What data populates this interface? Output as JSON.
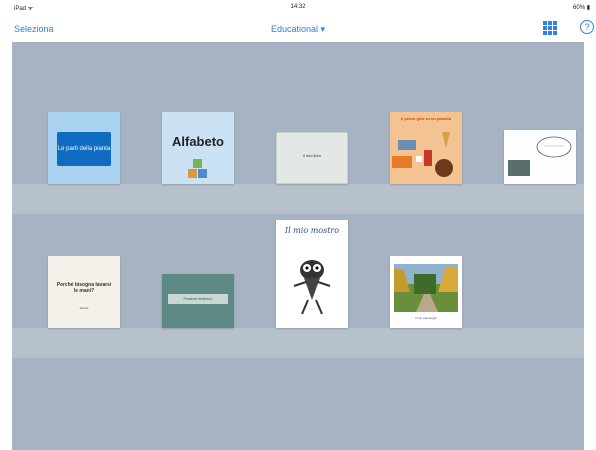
{
  "status_bar": {
    "carrier": "iPad ᯤ",
    "time": "14:32",
    "battery": "60% ▮"
  },
  "nav": {
    "select_label": "Seleziona",
    "title": "Educational ▾",
    "help_label": "?"
  },
  "books": [
    {
      "title": "Le parti della pianta"
    },
    {
      "title": "Alfabeto"
    },
    {
      "title": "Il mio libro"
    },
    {
      "title": "Il primo giro su un pianeta"
    },
    {
      "title": ""
    },
    {
      "title": "Perché bisogna lavarsi le mani?",
      "author": "Autore"
    },
    {
      "title": "Pastore tedesco"
    },
    {
      "title": "Il mio mostro"
    },
    {
      "title": "",
      "caption": "Il mio paesaggio"
    }
  ],
  "colors": {
    "accent": "#2f7fe4",
    "shelf_bg": "#a6b3c2",
    "shelf_band": "#b6c1cc"
  }
}
